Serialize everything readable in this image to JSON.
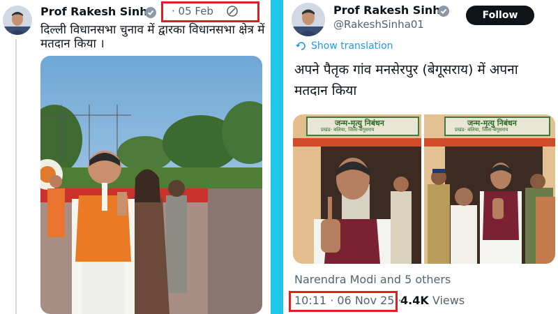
{
  "left_post": {
    "author": "Prof Rakesh Sinha",
    "date": "· 05 Feb",
    "text_line1": "दिल्ली विधानसभा चुनाव में द्वारका  विधानसभा क्षेत्र में",
    "text_line2": "मतदान किया ।"
  },
  "right_post": {
    "author": "Prof Rakesh Sinha",
    "handle": "@RakeshSinha01",
    "follow_label": "Follow",
    "translate_label": "Show translation",
    "text_line1": "अपने पैतृक गांव मनसेरपुर (बेगूसराय) में अपना",
    "text_line2": "मतदान किया",
    "image1_sign_line1": "जन्म-मृत्यु निबंधन",
    "image1_sign_line2": "प्रखंड- बलिया, जिला-बेगूसराय",
    "image2_sign_line1": "जन्म-मृत्यु निबंधन",
    "image2_sign_line2": "प्रखंड- बलिया, जिला-बेगूसराय",
    "likes_text": "Narendra Modi and 5 others",
    "timestamp": "10:11 · 06 Nov 25 ·",
    "views_count": "4.4K",
    "views_label": "Views"
  },
  "colors": {
    "divider": "#1ec7e6",
    "highlight_box": "#e11d1d",
    "follow_button": "#0f1419",
    "link_gray": "#536471"
  },
  "icons": [
    "verified-badge-icon",
    "edited-icon",
    "translate-icon"
  ]
}
